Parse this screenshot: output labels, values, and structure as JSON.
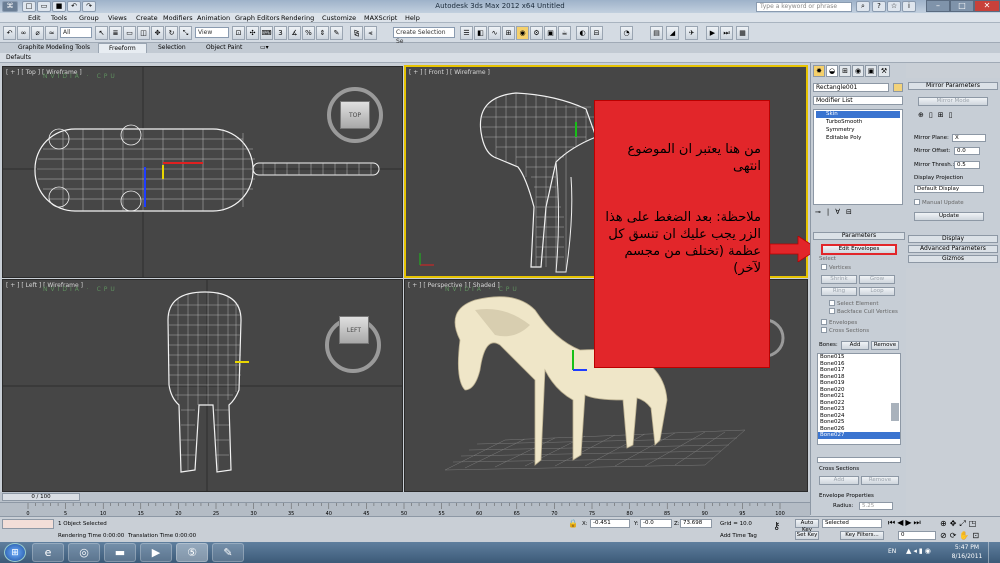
{
  "window": {
    "title": "Autodesk 3ds Max  2012 x64      Untitled",
    "search_placeholder": "Type a keyword or phrase"
  },
  "menu": [
    "Edit",
    "Tools",
    "Group",
    "Views",
    "Create",
    "Modifiers",
    "Animation",
    "Graph Editors",
    "Rendering",
    "Customize",
    "MAXScript",
    "Help"
  ],
  "toolbar": {
    "filter": "All",
    "refcoord": "View",
    "selection_set": "Create Selection Se"
  },
  "ribbon": {
    "tabs": [
      "Graphite Modeling Tools",
      "Freeform",
      "Selection",
      "Object Paint"
    ],
    "sub": "Defaults"
  },
  "viewports": {
    "top": {
      "label": "[ + ] [ Top ] [ Wireframe ]",
      "cube": "TOP"
    },
    "front": {
      "label": "[ + ] [ Front ] [ Wireframe ]"
    },
    "left": {
      "label": "[ + ] [ Left ] [ Wireframe ]",
      "cube": "LEFT"
    },
    "persp": {
      "label": "[ + ] [ Perspective ] [ Shaded ]"
    },
    "nvidia": "NVIDIA · CPU"
  },
  "callout": {
    "line1": "من هنا يعتبر ان الموضوع انتهى",
    "line2": "ملاحظة: بعد الضغط على هذا الزر يجب عليك ان تنسق كل عظمة (تختلف من مجسم لآخر)"
  },
  "command_panel": {
    "object_name": "Rectangle001",
    "modifier_list": "Modifier List",
    "stack": [
      "Skin",
      "TurboSmooth",
      "Symmetry",
      "Editable Poly"
    ],
    "parameters": "Parameters",
    "edit_envelopes": "Edit Envelopes",
    "select_label": "Select",
    "vertices": "Vertices",
    "shrink": "Shrink",
    "grow": "Grow",
    "ring": "Ring",
    "loop": "Loop",
    "select_element": "Select Element",
    "backface": "Backface Cull Vertices",
    "envelopes": "Envelopes",
    "cross_sections": "Cross Sections",
    "bones_label": "Bones:",
    "add": "Add",
    "remove": "Remove",
    "bones": [
      "Bone015",
      "Bone016",
      "Bone017",
      "Bone018",
      "Bone019",
      "Bone020",
      "Bone021",
      "Bone022",
      "Bone023",
      "Bone024",
      "Bone025",
      "Bone026",
      "Bone027"
    ],
    "cross_sections_title": "Cross Sections",
    "cs_add": "Add",
    "cs_remove": "Remove",
    "envelope_props": "Envelope Properties",
    "radius_label": "Radius:",
    "radius_value": "5.25"
  },
  "mirror": {
    "title": "Mirror Parameters",
    "mirror_mode": "Mirror Mode",
    "plane_label": "Mirror Plane:",
    "plane_value": "X",
    "offset_label": "Mirror Offset:",
    "offset_value": "0.0",
    "thresh_label": "Mirror Thresh.:",
    "thresh_value": "0.5",
    "display_proj": "Display Projection",
    "proj_value": "Default Display",
    "manual_update": "Manual Update",
    "update": "Update",
    "display": "Display",
    "advanced": "Advanced Parameters",
    "gizmos": "Gizmos"
  },
  "timeline": {
    "frame": "0 / 100",
    "ticks": [
      "0",
      "5",
      "10",
      "15",
      "20",
      "25",
      "30",
      "35",
      "40",
      "45",
      "50",
      "55",
      "60",
      "65",
      "70",
      "75",
      "80",
      "85",
      "90",
      "95",
      "100"
    ]
  },
  "status": {
    "selected": "1 Object Selected",
    "render_time": "Rendering Time  0:00:00",
    "translate_time": "Translation Time  0:00:00",
    "x_label": "X:",
    "x": "-0.451",
    "y_label": "Y:",
    "y": "-0.0",
    "z_label": "Z:",
    "z": "73.698",
    "grid": "Grid = 10.0",
    "add_time_tag": "Add Time Tag",
    "auto_key": "Auto Key",
    "set_key": "Set Key",
    "selected_dd": "Selected",
    "key_filters": "Key Filters...",
    "frame_value": "0"
  },
  "taskbar": {
    "lang": "EN",
    "time": "5:47 PM",
    "date": "8/16/2011"
  }
}
